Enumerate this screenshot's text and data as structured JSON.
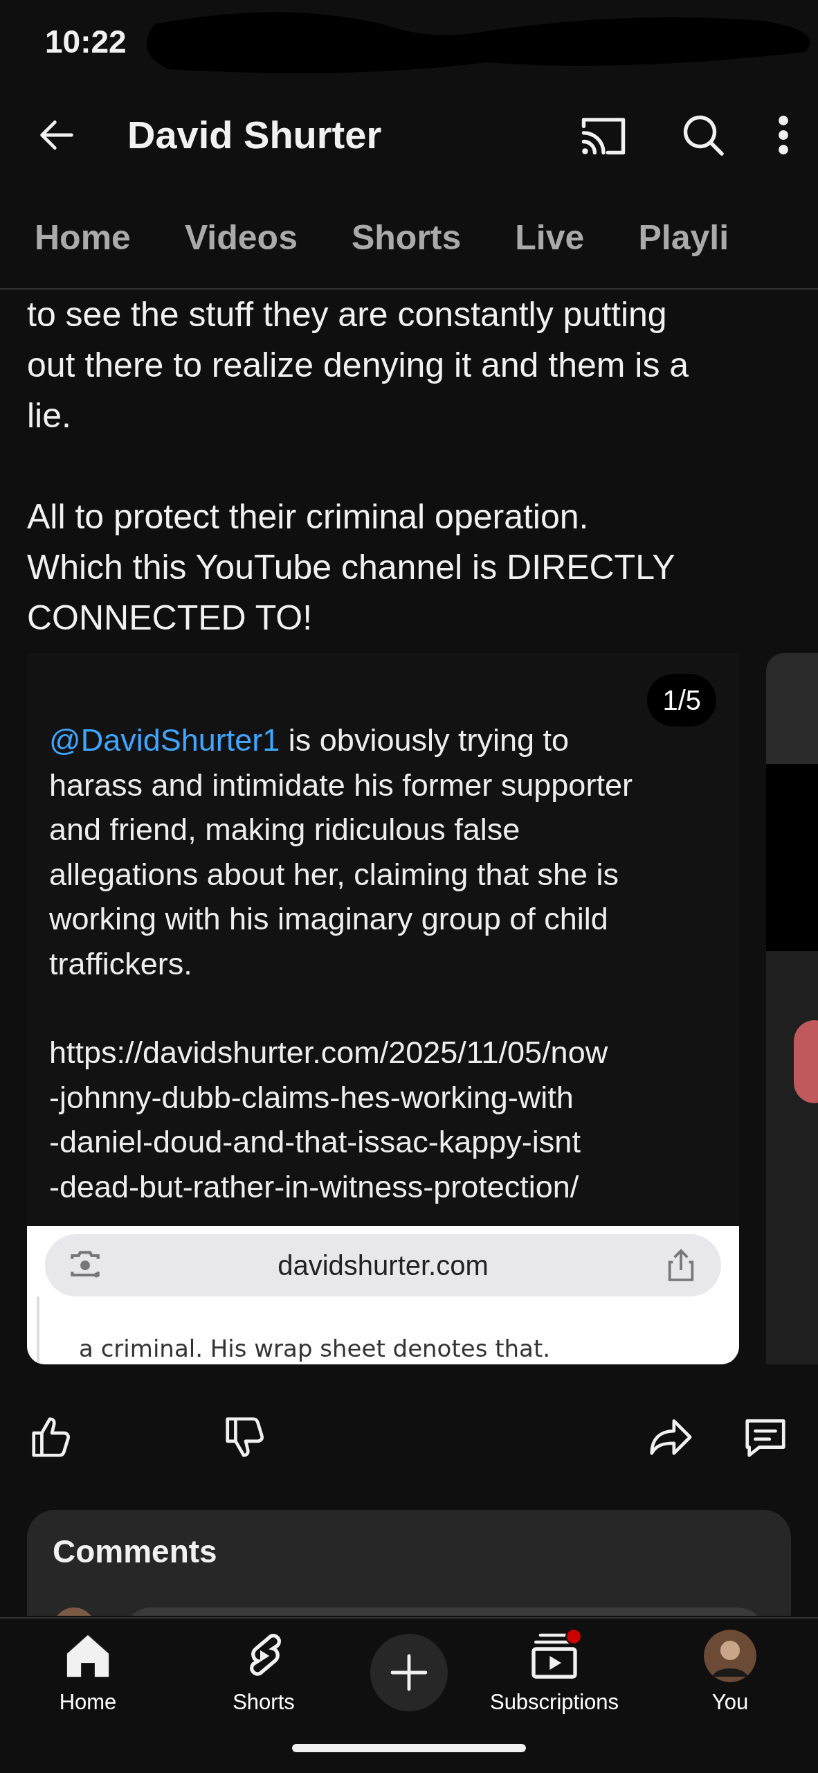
{
  "status_bar": {
    "time": "10:22"
  },
  "app_bar": {
    "title": "David Shurter"
  },
  "tabs": [
    {
      "label": "Home",
      "selected": false
    },
    {
      "label": "Videos",
      "selected": false
    },
    {
      "label": "Shorts",
      "selected": false
    },
    {
      "label": "Live",
      "selected": false
    },
    {
      "label": "Playli",
      "selected": false
    }
  ],
  "post": {
    "paragraphs": [
      [
        "to see the stuff they are constantly putting",
        "out there to realize denying it and them is a",
        "lie."
      ],
      [
        "All to protect their criminal operation.",
        " Which this YouTube channel is DIRECTLY",
        "CONNECTED TO!"
      ]
    ]
  },
  "image": {
    "counter": "1/5",
    "mention": "@DavidShurter1",
    "mention_rest": [
      "is obviously trying to",
      "harass and intimidate his former supporter",
      "and friend, making ridiculous false",
      "allegations about her, claiming that she is",
      "working with his imaginary group of child",
      "traffickers."
    ],
    "url_lines": [
      "https://davidshurter.com/2025/11/05/now",
      "-johnny-dubb-claims-hes-working-with",
      "-daniel-doud-and-that-issac-kappy-isnt",
      "-dead-but-rather-in-witness-protection/"
    ],
    "browser_url": "davidshurter.com",
    "page_text": "a criminal. His wrap sheet denotes that."
  },
  "comments": {
    "title": "Comments"
  },
  "nav": [
    {
      "kind": "tab",
      "label": "Home",
      "selected": true
    },
    {
      "kind": "tab",
      "label": "Shorts",
      "selected": false
    },
    {
      "kind": "create"
    },
    {
      "kind": "tab",
      "label": "Subscriptions",
      "selected": false,
      "badge": true
    },
    {
      "kind": "avatar",
      "label": "You",
      "selected": false
    }
  ]
}
